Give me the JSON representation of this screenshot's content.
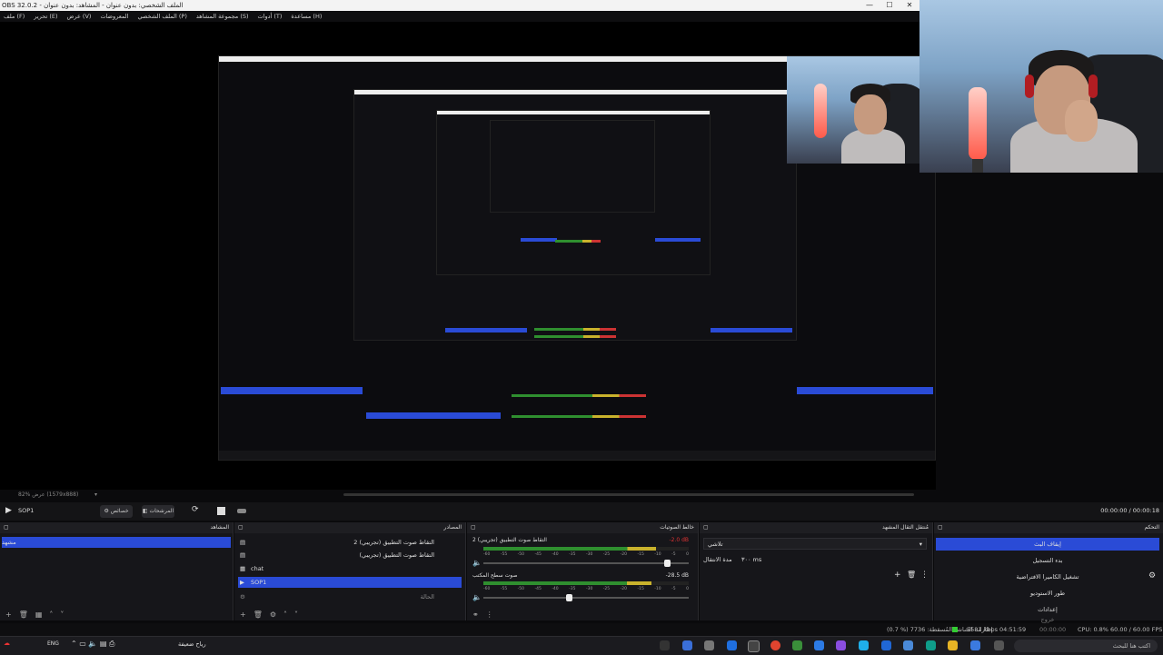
{
  "window": {
    "title": "OBS 32.0.2 - الملف الشخصي: بدون عنوان - المشاهد: بدون عنوان",
    "controls": [
      "—",
      "☐",
      "✕"
    ]
  },
  "menubar": [
    "ملف (F)",
    "تحرير (E)",
    "عرض (V)",
    "المعروضات",
    "الملف الشخصي (P)",
    "مجموعة المشاهد (S)",
    "أدوات (T)",
    "مساعدة (H)"
  ],
  "zoom": {
    "label": "82% عرض (1579x888)"
  },
  "controls": {
    "scene_name": "SOP1",
    "btn_properties": "خصائص",
    "btn_filters": "المرشحات",
    "timecode": "00:00:00 / 00:00:18"
  },
  "docks": {
    "scenes": {
      "title": "المشاهد",
      "items": [
        "مشهد"
      ]
    },
    "sources": {
      "title": "المصادر",
      "items": [
        "التقاط صوت التطبيق (تجريبي) 2",
        "التقاط صوت التطبيق (تجريبي)",
        "chat",
        "SOP1",
        "الحالة"
      ]
    },
    "mixer": {
      "title": "خالط الصوتيات",
      "channels": [
        {
          "name": "التقاط صوت التطبيق (تجريبي) 2",
          "db": "-2.0 dB",
          "level": 0.84,
          "volume": 0.9
        },
        {
          "name": "صوت سطح المكتب",
          "db": "-28.5 dB",
          "level": 0.82,
          "volume": 0.42
        }
      ],
      "scale": [
        "-60",
        "-55",
        "-50",
        "-45",
        "-40",
        "-35",
        "-30",
        "-25",
        "-20",
        "-15",
        "-10",
        "-5",
        "0"
      ]
    },
    "transitions": {
      "title": "مُنتقل التقال المشهد",
      "type": "تلاشي",
      "duration_label": "مدة الانتقال",
      "duration": "٣٠٠ ms"
    },
    "controls": {
      "title": "التحكم",
      "buttons": [
        "إيقاف البث",
        "بدء التسجيل",
        "تشغيل الكاميرا الافتراضية",
        "طور الاستوديو",
        "إعدادات",
        "خروج"
      ]
    }
  },
  "status": {
    "frames": "(0.7 %) 7736 :إطارات الشاشة المُسقطة",
    "kbps": "5581 kbps",
    "time1": "04:51:59",
    "time2": "00:00:00",
    "cpu": "CPU: 0.8%",
    "fps": "60.00 / 60.00 FPS"
  },
  "taskbar": {
    "lang": "ENG",
    "search": "اكتب هنا للبحث",
    "tray_text": "رياح ضعيفة"
  },
  "colors": {
    "accent": "#2a4bd6",
    "background": "#0a0a0c"
  }
}
